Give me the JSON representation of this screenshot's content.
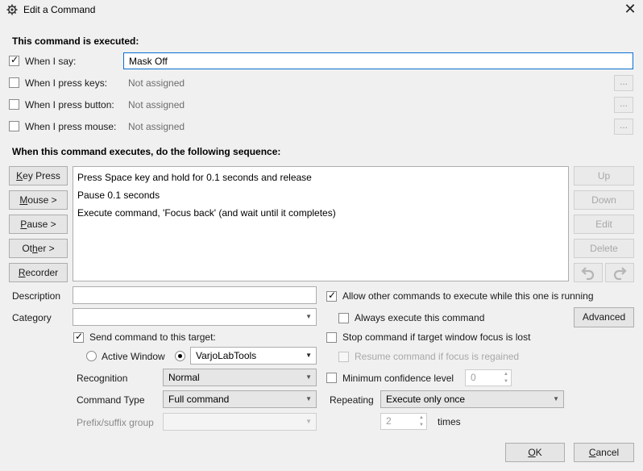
{
  "window": {
    "title": "Edit a Command"
  },
  "section_executed": "This command is executed:",
  "triggers": {
    "say": {
      "label": "When I say:",
      "value": "Mask Off",
      "checked": true
    },
    "keys": {
      "label": "When I press keys:",
      "value": "Not assigned",
      "more": "..."
    },
    "button": {
      "label": "When I press button:",
      "value": "Not assigned",
      "more": "..."
    },
    "mouse": {
      "label": "When I press mouse:",
      "value": "Not assigned",
      "more": "..."
    }
  },
  "section_sequence": "When this command executes, do the following sequence:",
  "left_buttons": {
    "key_press": {
      "u": "K",
      "rest": "ey Press"
    },
    "mouse": {
      "u": "M",
      "rest": "ouse >"
    },
    "pause": {
      "u": "P",
      "rest": "ause >"
    },
    "other": {
      "pre": "Ot",
      "u": "h",
      "rest": "er >"
    },
    "recorder": {
      "u": "R",
      "rest": "ecorder"
    }
  },
  "sequence": [
    "Press Space key and hold for 0.1 seconds and release",
    "Pause 0.1 seconds",
    "Execute command, 'Focus back' (and wait until it completes)"
  ],
  "right_buttons": {
    "up": "Up",
    "down": "Down",
    "edit": "Edit",
    "delete": "Delete",
    "undo_icon": "undo-icon",
    "redo_icon": "redo-icon"
  },
  "description": {
    "label": "Description",
    "value": ""
  },
  "category": {
    "label": "Category",
    "value": ""
  },
  "send_target": {
    "label": "Send command to this target:",
    "checked": true
  },
  "active_window": {
    "label": "Active Window"
  },
  "target_app": {
    "value": "VarjoLabTools"
  },
  "recognition": {
    "label": "Recognition",
    "value": "Normal"
  },
  "command_type": {
    "label": "Command Type",
    "value": "Full command"
  },
  "prefix_group": {
    "label": "Prefix/suffix group",
    "value": ""
  },
  "options": {
    "allow_other": {
      "label": "Allow other commands to execute while this one is running",
      "checked": true
    },
    "always_execute": {
      "label": "Always execute this command"
    },
    "advanced": "Advanced",
    "stop_focus": {
      "label": "Stop command if target window focus is lost"
    },
    "resume_focus": {
      "label": "Resume command if focus is regained"
    },
    "min_confidence": {
      "label": "Minimum confidence level",
      "value": "0"
    }
  },
  "repeating": {
    "label": "Repeating",
    "value": "Execute only once",
    "times_value": "2",
    "times_label": "times"
  },
  "footer": {
    "ok": {
      "u": "O",
      "rest": "K"
    },
    "cancel": {
      "u": "C",
      "rest": "ancel"
    }
  },
  "colors": {
    "focus_border": "#0a6ed1",
    "window_bg": "#f0f0f0"
  }
}
